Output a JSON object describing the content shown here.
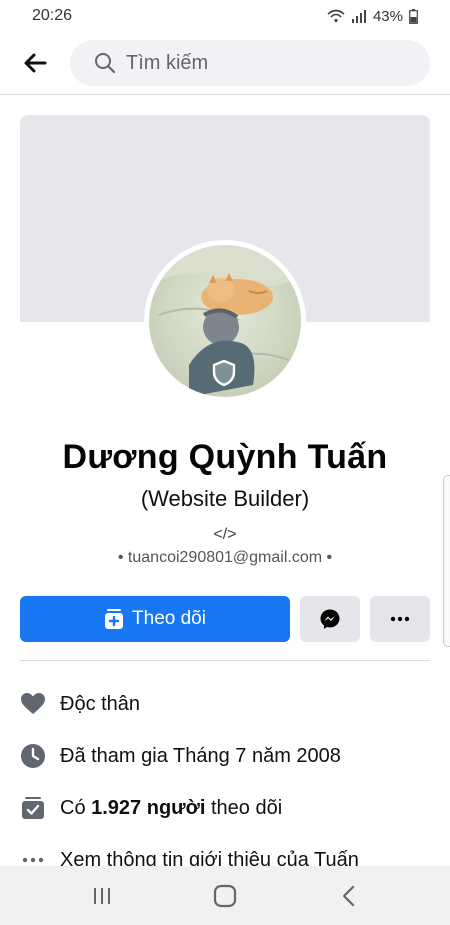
{
  "status_bar": {
    "time": "20:26",
    "battery": "43%"
  },
  "search": {
    "placeholder": "Tìm kiếm"
  },
  "profile": {
    "name": "Dương Quỳnh Tuấn",
    "subtitle": "(Website Builder)",
    "code_tag": "</>",
    "email_line": "• tuancoi290801@gmail.com •"
  },
  "actions": {
    "follow_label": "Theo dõi"
  },
  "info": [
    {
      "icon": "heart-icon",
      "text": "Độc thân"
    },
    {
      "icon": "clock-icon",
      "text": "Đã tham gia Tháng 7 năm 2008"
    },
    {
      "icon": "follower-icon",
      "text_prefix": "Có ",
      "text_bold": "1.927 người",
      "text_suffix": " theo dõi"
    },
    {
      "icon": "more-dots-icon",
      "text": "Xem thông tin giới thiệu của Tuấn"
    }
  ],
  "colors": {
    "accent": "#1877f2",
    "cover": "#e6e7ea",
    "secondary_button": "#e4e6eb"
  }
}
